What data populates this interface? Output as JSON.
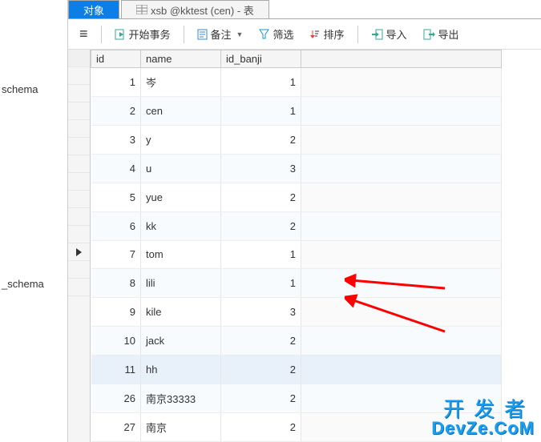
{
  "sidebar": {
    "items": [
      {
        "label": "schema"
      },
      {
        "label": "_schema"
      }
    ]
  },
  "tabs": {
    "active": {
      "label": "对象"
    },
    "inactive": {
      "icon": "table-icon",
      "label": "xsb @kktest (cen) - 表"
    }
  },
  "toolbar": {
    "menu": "≡",
    "begin_tx": "开始事务",
    "memo": "备注",
    "filter": "筛选",
    "sort": "排序",
    "import": "导入",
    "export": "导出"
  },
  "columns": {
    "id": "id",
    "name": "name",
    "id_banji": "id_banji"
  },
  "rows": [
    {
      "id": 1,
      "name": "岑",
      "id_banji": 1
    },
    {
      "id": 2,
      "name": "cen",
      "id_banji": 1
    },
    {
      "id": 3,
      "name": "y",
      "id_banji": 2
    },
    {
      "id": 4,
      "name": "u",
      "id_banji": 3
    },
    {
      "id": 5,
      "name": "yue",
      "id_banji": 2
    },
    {
      "id": 6,
      "name": "kk",
      "id_banji": 2
    },
    {
      "id": 7,
      "name": "tom",
      "id_banji": 1
    },
    {
      "id": 8,
      "name": "lili",
      "id_banji": 1
    },
    {
      "id": 9,
      "name": "kile",
      "id_banji": 3
    },
    {
      "id": 10,
      "name": "jack",
      "id_banji": 2
    },
    {
      "id": 11,
      "name": "hh",
      "id_banji": 2
    },
    {
      "id": 26,
      "name": "南京33333",
      "id_banji": 2
    },
    {
      "id": 27,
      "name": "南京",
      "id_banji": 2
    }
  ],
  "current_row_index": 10,
  "watermark": {
    "line1": "开发者",
    "line2": "DevZe.CoM"
  }
}
